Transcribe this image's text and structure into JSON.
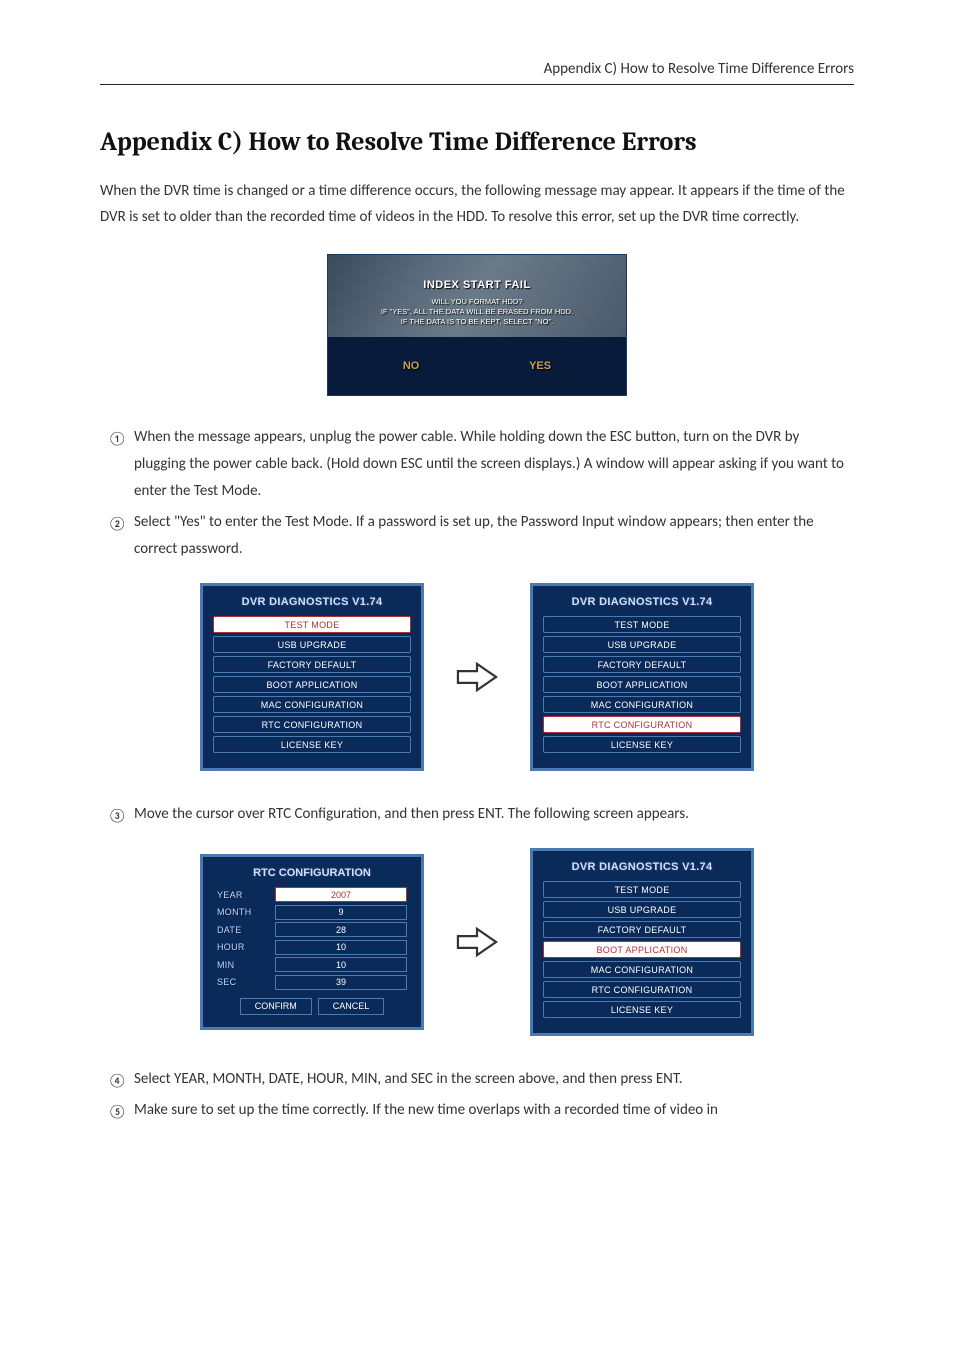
{
  "header": {
    "text": "Appendix C) How to Resolve Time Difference Errors"
  },
  "title": "Appendix C) How to Resolve Time Difference Errors",
  "intro": "When the DVR time is changed or a time difference occurs, the following message may appear. It appears if the time of the DVR is set to older than the recorded time of videos in the HDD. To resolve this error, set up the DVR time correctly.",
  "dialog": {
    "title": "INDEX START FAIL",
    "line1": "WILL YOU FORMAT HDD?",
    "line2": "IF \"YES\", ALL THE DATA WILL BE ERASED FROM HDD.",
    "line3": "IF THE DATA IS TO BE KEPT, SELECT \"NO\".",
    "no": "NO",
    "yes": "YES"
  },
  "steps12": [
    {
      "num": "①",
      "text": "When the message appears, unplug the power cable. While holding down the ESC button, turn on the DVR by plugging the power cable back. (Hold down ESC until the screen displays.) A window will appear asking if you want to enter the Test Mode."
    },
    {
      "num": "②",
      "text": "Select \"Yes\" to enter the Test Mode. If a password is set up, the Password Input window appears; then enter the correct password."
    }
  ],
  "diag": {
    "title": "DVR DIAGNOSTICS V1.74",
    "items": [
      "TEST MODE",
      "USB UPGRADE",
      "FACTORY DEFAULT",
      "BOOT APPLICATION",
      "MAC CONFIGURATION",
      "RTC CONFIGURATION",
      "LICENSE KEY"
    ],
    "sel_left": 0,
    "sel_right": 5
  },
  "step3": {
    "num": "③",
    "text": "Move the cursor over RTC Configuration, and then press ENT. The following screen appears."
  },
  "rtc": {
    "title": "RTC CONFIGURATION",
    "rows": [
      {
        "label": "YEAR",
        "value": "2007",
        "selected": true
      },
      {
        "label": "MONTH",
        "value": "9",
        "selected": false
      },
      {
        "label": "DATE",
        "value": "28",
        "selected": false
      },
      {
        "label": "HOUR",
        "value": "10",
        "selected": false
      },
      {
        "label": "MIN",
        "value": "10",
        "selected": false
      },
      {
        "label": "SEC",
        "value": "39",
        "selected": false
      }
    ],
    "confirm": "CONFIRM",
    "cancel": "CANCEL"
  },
  "diag2_sel": 3,
  "steps45": [
    {
      "num": "④",
      "text": "Select YEAR, MONTH, DATE, HOUR, MIN, and SEC in the screen above, and then press ENT."
    },
    {
      "num": "⑤",
      "text": "Make sure to set up the time correctly. If the new time overlaps with a recorded time of video in"
    }
  ]
}
